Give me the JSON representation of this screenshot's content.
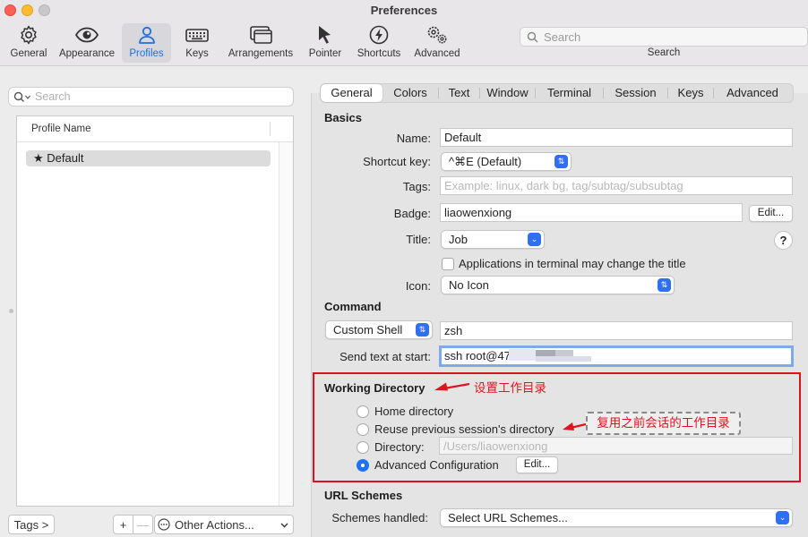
{
  "window": {
    "title": "Preferences"
  },
  "toolbar": {
    "items": [
      {
        "label": "General",
        "icon": "gear-icon"
      },
      {
        "label": "Appearance",
        "icon": "eye-icon"
      },
      {
        "label": "Profiles",
        "icon": "person-icon",
        "active": true
      },
      {
        "label": "Keys",
        "icon": "keyboard-icon"
      },
      {
        "label": "Arrangements",
        "icon": "windows-icon"
      },
      {
        "label": "Pointer",
        "icon": "cursor-icon"
      },
      {
        "label": "Shortcuts",
        "icon": "bolt-icon"
      },
      {
        "label": "Advanced",
        "icon": "gears-icon"
      }
    ],
    "search_placeholder": "Search",
    "search_label": "Search"
  },
  "sidebar": {
    "search_placeholder": "Search",
    "column_header": "Profile Name",
    "profiles": [
      {
        "name": "Default",
        "starred": true,
        "selected": true
      }
    ],
    "tags_button": "Tags >",
    "add_button": "+",
    "remove_button": "—",
    "other_actions": "Other Actions..."
  },
  "tabs": [
    "General",
    "Colors",
    "Text",
    "Window",
    "Terminal",
    "Session",
    "Keys",
    "Advanced"
  ],
  "active_tab": "General",
  "basics": {
    "header": "Basics",
    "name_label": "Name:",
    "name_value": "Default",
    "shortcut_label": "Shortcut key:",
    "shortcut_value": "^⌘E (Default)",
    "tags_label": "Tags:",
    "tags_placeholder": "Example: linux, dark bg, tag/subtag/subsubtag",
    "badge_label": "Badge:",
    "badge_value": "liaowenxiong",
    "badge_edit": "Edit...",
    "title_label": "Title:",
    "title_value": "Job",
    "help": "?",
    "title_change_checkbox": "Applications in terminal may change the title",
    "icon_label": "Icon:",
    "icon_value": "No Icon"
  },
  "command": {
    "header": "Command",
    "type_value": "Custom Shell",
    "command_value": "zsh",
    "send_text_label": "Send text at start:",
    "send_text_value": "ssh root@47"
  },
  "working_directory": {
    "header": "Working Directory",
    "annotation_main": "设置工作目录",
    "options": [
      {
        "label": "Home directory",
        "selected": false
      },
      {
        "label": "Reuse previous session's directory",
        "selected": false
      },
      {
        "label": "Directory:",
        "selected": false
      },
      {
        "label": "Advanced Configuration",
        "selected": true
      }
    ],
    "directory_placeholder": "/Users/liaowenxiong",
    "advanced_edit": "Edit...",
    "annotation_reuse": "复用之前会话的工作目录"
  },
  "url_schemes": {
    "header": "URL Schemes",
    "label": "Schemes handled:",
    "value": "Select URL Schemes..."
  },
  "colors": {
    "accent": "#2f6ff4",
    "annotation_red": "#e0141f",
    "traffic_close": "#fe5f57",
    "traffic_min": "#febc2e",
    "traffic_max": "#c8c8c8"
  }
}
